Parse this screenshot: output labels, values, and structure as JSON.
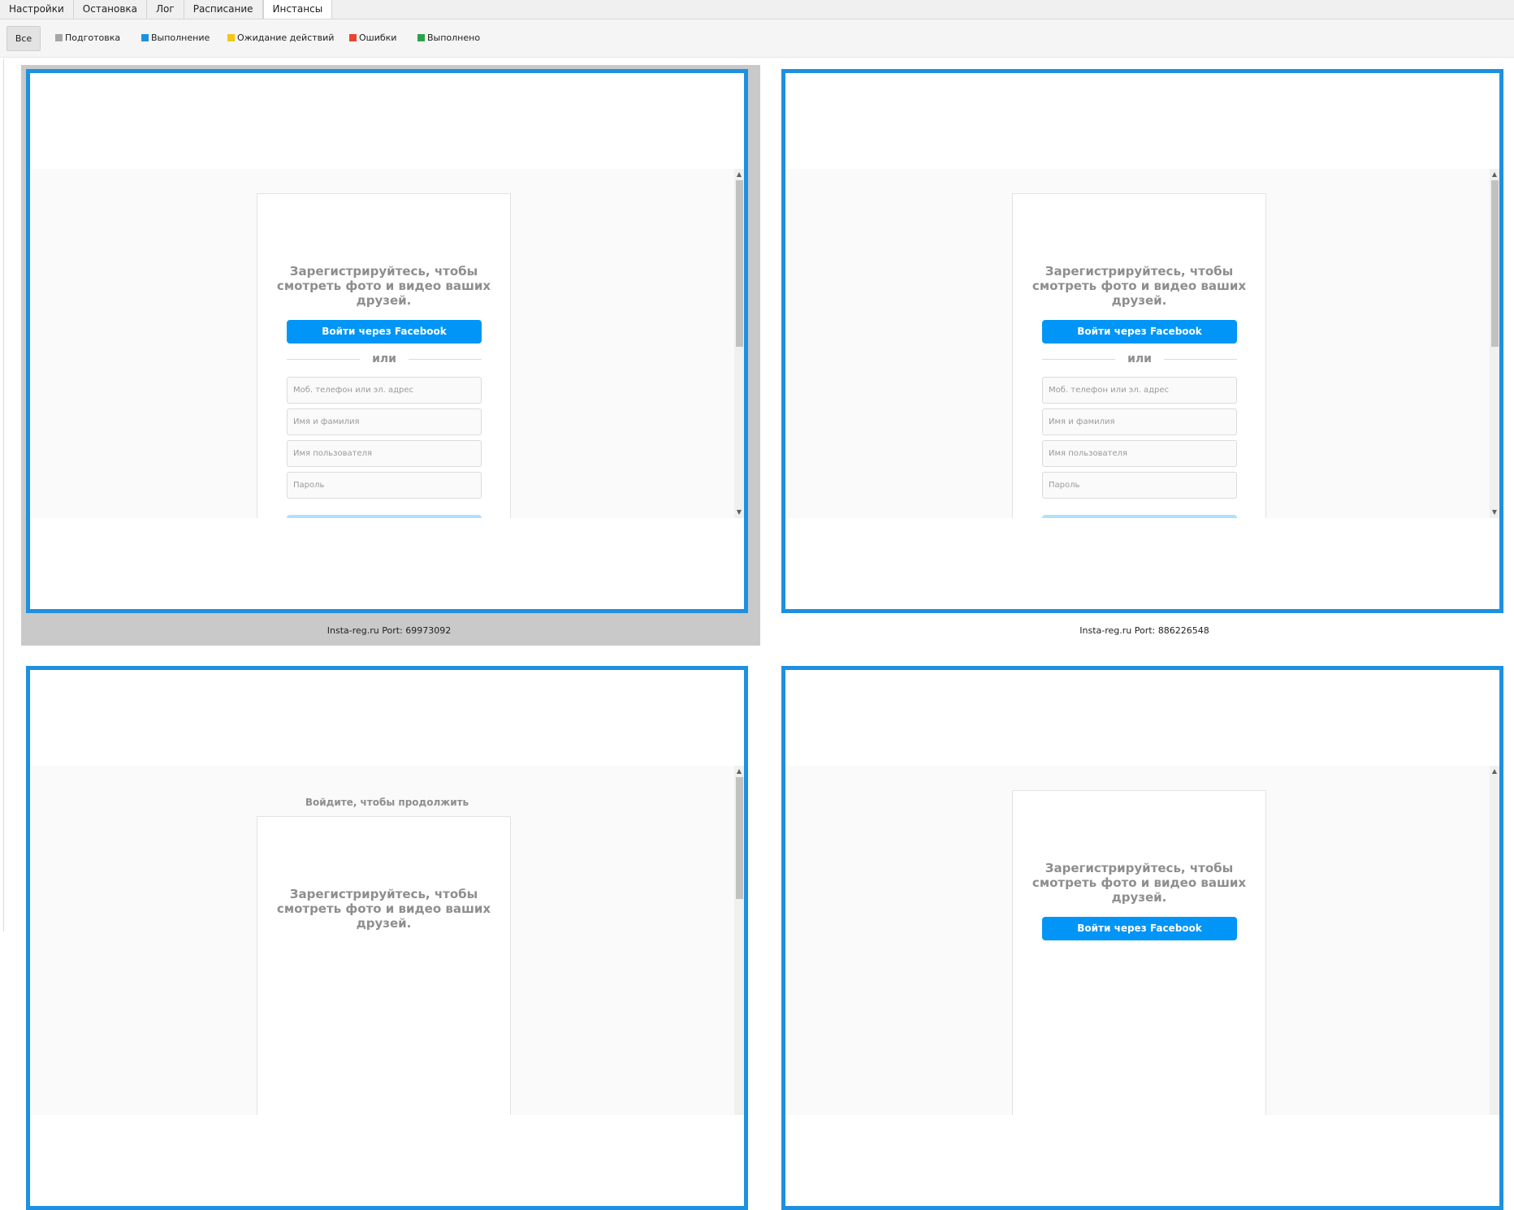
{
  "tabs": [
    {
      "label": "Настройки",
      "active": false
    },
    {
      "label": "Остановка",
      "active": false
    },
    {
      "label": "Лог",
      "active": false
    },
    {
      "label": "Расписание",
      "active": false
    },
    {
      "label": "Инстансы",
      "active": true
    }
  ],
  "filters": {
    "all_label": "Все",
    "items": [
      {
        "label": "Подготовка",
        "color": "#a6a6a6"
      },
      {
        "label": "Выполнение",
        "color": "#1e90e0"
      },
      {
        "label": "Ожидание действий",
        "color": "#f5c518"
      },
      {
        "label": "Ошибки",
        "color": "#e8452c"
      },
      {
        "label": "Выполнено",
        "color": "#2ca34a"
      }
    ]
  },
  "instances": [
    {
      "caption": "Insta-reg.ru Port: 69973092",
      "selected": true,
      "page": {
        "headline": "Зарегистрируйтесь, чтобы смотреть фото и видео ваших друзей.",
        "fb_button": "Войти через Facebook",
        "or_text": "или",
        "fields": [
          "Моб. телефон или эл. адрес",
          "Имя и фамилия",
          "Имя пользователя",
          "Пароль"
        ]
      }
    },
    {
      "caption": "Insta-reg.ru Port: 886226548",
      "selected": false,
      "page": {
        "headline": "Зарегистрируйтесь, чтобы смотреть фото и видео ваших друзей.",
        "fb_button": "Войти через Facebook",
        "or_text": "или",
        "fields": [
          "Моб. телефон или эл. адрес",
          "Имя и фамилия",
          "Имя пользователя",
          "Пароль"
        ]
      }
    },
    {
      "caption": "",
      "selected": false,
      "page": {
        "login_prompt": "Войдите, чтобы продолжить",
        "headline": "Зарегистрируйтесь, чтобы смотреть фото и видео ваших друзей."
      }
    },
    {
      "caption": "",
      "selected": false,
      "page": {
        "headline": "Зарегистрируйтесь, чтобы смотреть фото и видео ваших друзей.",
        "fb_button": "Войти через Facebook"
      }
    }
  ],
  "colors": {
    "running_border": "#1e90e0",
    "selection_bg": "#c9c9c9",
    "facebook_blue": "#0095f6"
  }
}
